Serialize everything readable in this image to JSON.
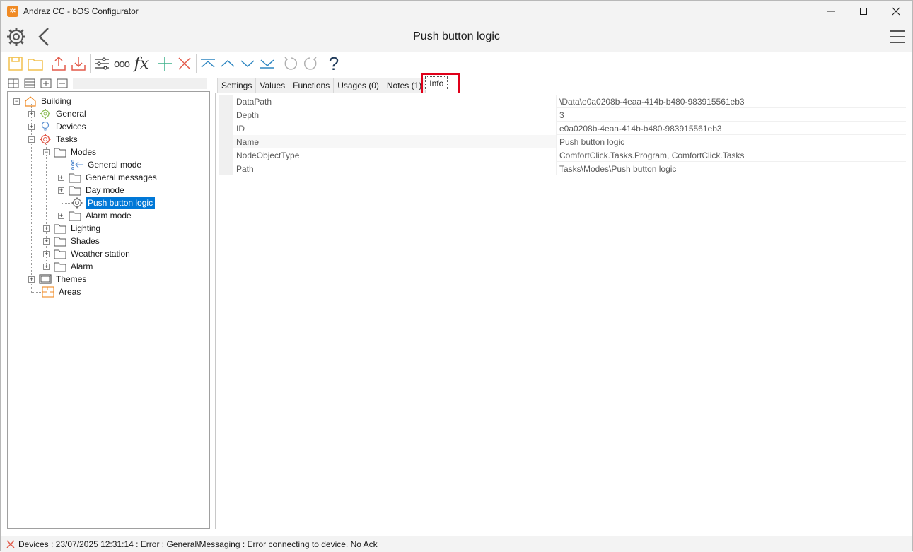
{
  "window": {
    "title": "Andraz CC - bOS Configurator",
    "controls": [
      "minimize-icon",
      "maximize-icon",
      "close-icon"
    ]
  },
  "header": {
    "page_title": "Push button logic",
    "icons": [
      "gear-icon",
      "back-icon",
      "hamburger-menu-icon"
    ]
  },
  "toolbar": {
    "icons": [
      "new-icon",
      "open-folder-icon",
      "upload-icon",
      "download-icon",
      "settings-sliders-icon",
      "more-icon",
      "function-icon",
      "add-icon",
      "delete-icon",
      "move-top-icon",
      "move-up-icon",
      "move-down-icon",
      "move-bottom-icon",
      "undo-icon",
      "redo-icon"
    ],
    "function_glyph": "fx",
    "more_glyph": "ooo",
    "help_glyph": "?"
  },
  "tree": {
    "tools": [
      "expand-all-icon",
      "collapse-all-icon",
      "expand-icon",
      "collapse-icon"
    ],
    "nodes": [
      {
        "label": "Building",
        "icon": "house-icon",
        "expander": "−"
      },
      {
        "label": "General",
        "icon": "gear-icon",
        "expander": "+"
      },
      {
        "label": "Devices",
        "icon": "bulb-icon",
        "expander": "+"
      },
      {
        "label": "Tasks",
        "icon": "tasks-gear-icon",
        "expander": "−"
      },
      {
        "label": "Modes",
        "icon": "folder-icon",
        "expander": "−"
      },
      {
        "label": "General mode",
        "icon": "mode-icon",
        "expander": ""
      },
      {
        "label": "General messages",
        "icon": "folder-icon",
        "expander": "+"
      },
      {
        "label": "Day mode",
        "icon": "folder-icon",
        "expander": "+"
      },
      {
        "label": "Push button logic",
        "icon": "program-gear-icon",
        "expander": "",
        "selected": true
      },
      {
        "label": "Alarm mode",
        "icon": "folder-icon",
        "expander": "+"
      },
      {
        "label": "Lighting",
        "icon": "folder-icon",
        "expander": "+"
      },
      {
        "label": "Shades",
        "icon": "folder-icon",
        "expander": "+"
      },
      {
        "label": "Weather station",
        "icon": "folder-icon",
        "expander": "+"
      },
      {
        "label": "Alarm",
        "icon": "folder-icon",
        "expander": "+"
      },
      {
        "label": "Themes",
        "icon": "monitor-icon",
        "expander": "+"
      },
      {
        "label": "Areas",
        "icon": "areas-icon",
        "expander": ""
      }
    ]
  },
  "tabs": [
    {
      "label": "Settings"
    },
    {
      "label": "Values"
    },
    {
      "label": "Functions"
    },
    {
      "label": "Usages (0)"
    },
    {
      "label": "Notes (1)"
    },
    {
      "label": "Info",
      "active": true
    }
  ],
  "info": {
    "rows": [
      {
        "name": "DataPath",
        "value": "\\Data\\e0a0208b-4eaa-414b-b480-983915561eb3"
      },
      {
        "name": "Depth",
        "value": "3"
      },
      {
        "name": "ID",
        "value": "e0a0208b-4eaa-414b-b480-983915561eb3"
      },
      {
        "name": "Name",
        "value": "Push button logic"
      },
      {
        "name": "NodeObjectType",
        "value": "ComfortClick.Tasks.Program, ComfortClick.Tasks"
      },
      {
        "name": "Path",
        "value": "Tasks\\Modes\\Push button logic"
      }
    ]
  },
  "status": {
    "text": "Devices : 23/07/2025 12:31:14 : Error : General\\Messaging : Error connecting to device. No Ack",
    "icon": "error-x-icon"
  },
  "colors": {
    "accent_orange": "#f08a24",
    "selection_blue": "#0078d7",
    "error_red": "#e0001a",
    "add_green": "#3cb08a",
    "move_blue": "#2e86c1"
  }
}
